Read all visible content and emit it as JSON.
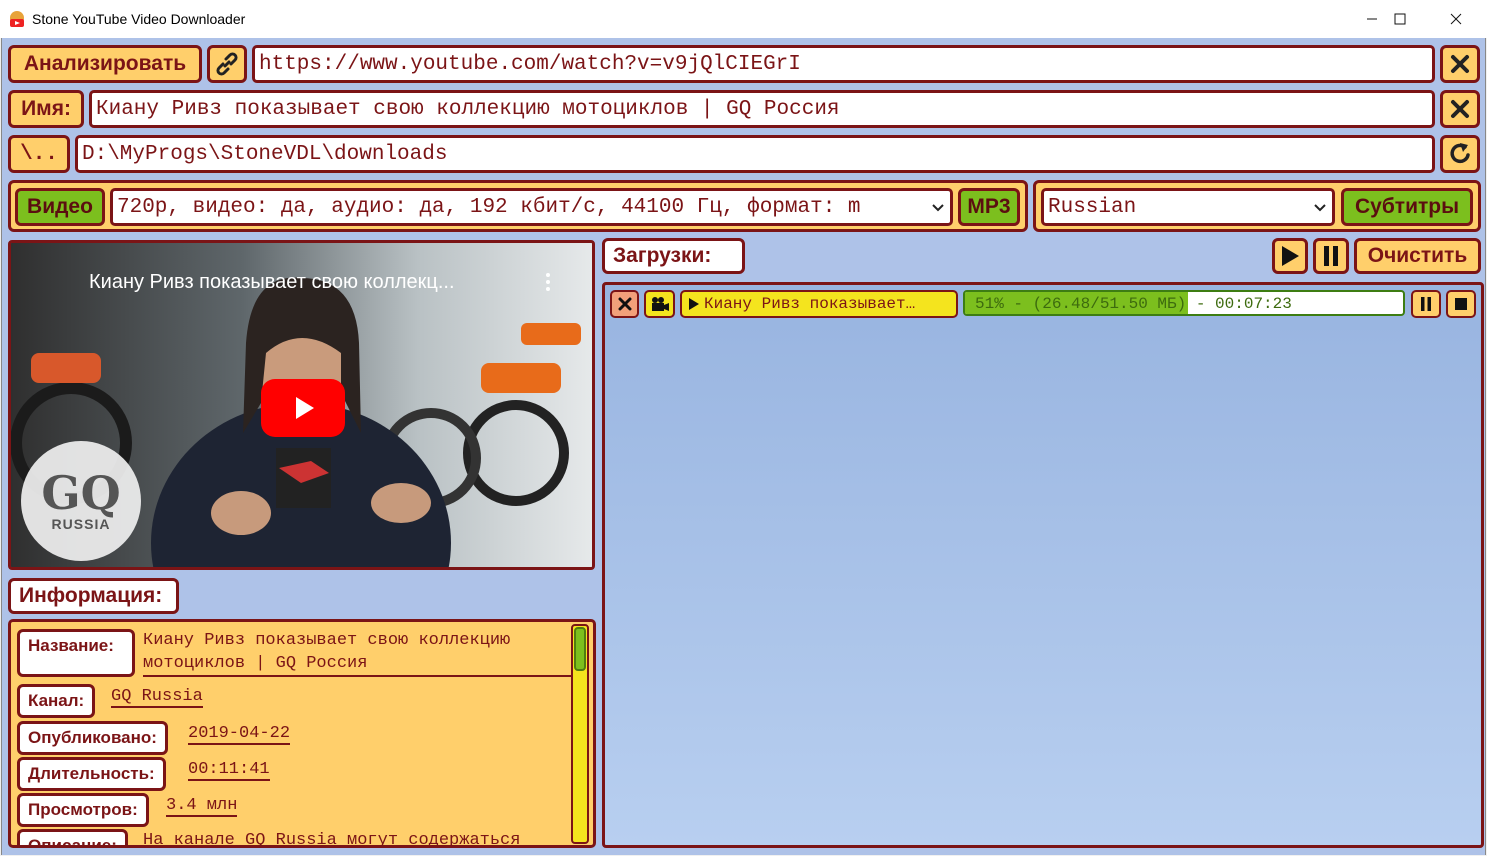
{
  "window": {
    "title": "Stone YouTube Video Downloader"
  },
  "toolbar": {
    "analyze_label": "Анализировать",
    "url_value": "https://www.youtube.com/watch?v=v9jQlCIEGrI",
    "name_label": "Имя:",
    "name_value": "Киану Ривз показывает свою коллекцию мотоциклов | GQ Россия",
    "folder_label": "\\..",
    "folder_value": "D:\\MyProgs\\StoneVDL\\downloads",
    "video_label": "Видео",
    "format_value": "720p, видео: да, аудио: да, 192 кбит/с, 44100 Гц, формат: m",
    "mp3_label": "MP3",
    "subtitle_language": "Russian",
    "subtitles_label": "Субтитры"
  },
  "preview": {
    "title": "Киану Ривз показывает свою коллекц...",
    "logo_main": "GQ",
    "logo_sub": "RUSSIA"
  },
  "info": {
    "heading": "Информация:",
    "rows": [
      {
        "label": "Название:",
        "value_line1": "Киану Ривз показывает свою коллекцию",
        "value_line2": "мотоциклов | GQ Россия"
      },
      {
        "label": "Канал:",
        "value": "GQ Russia"
      },
      {
        "label": "Опубликовано:",
        "value": "2019-04-22"
      },
      {
        "label": "Длительность:",
        "value": "00:11:41"
      },
      {
        "label": "Просмотров:",
        "value": "3.4 млн"
      },
      {
        "label": "Описание:",
        "value": "На канале GQ Russia могут содержаться"
      }
    ]
  },
  "downloads": {
    "heading": "Загрузки:",
    "clear_label": "Очистить",
    "items": [
      {
        "title": "Киану Ривз показывает…",
        "progress_text": "51% - (26.48/51.50 МБ) - 00:07:23",
        "progress": 0.51
      }
    ]
  },
  "colors": {
    "accent_border": "#7b1416",
    "button_orange": "#ffcf6b",
    "button_green": "#7cbf1e",
    "background_blue": "#aec2e8"
  }
}
